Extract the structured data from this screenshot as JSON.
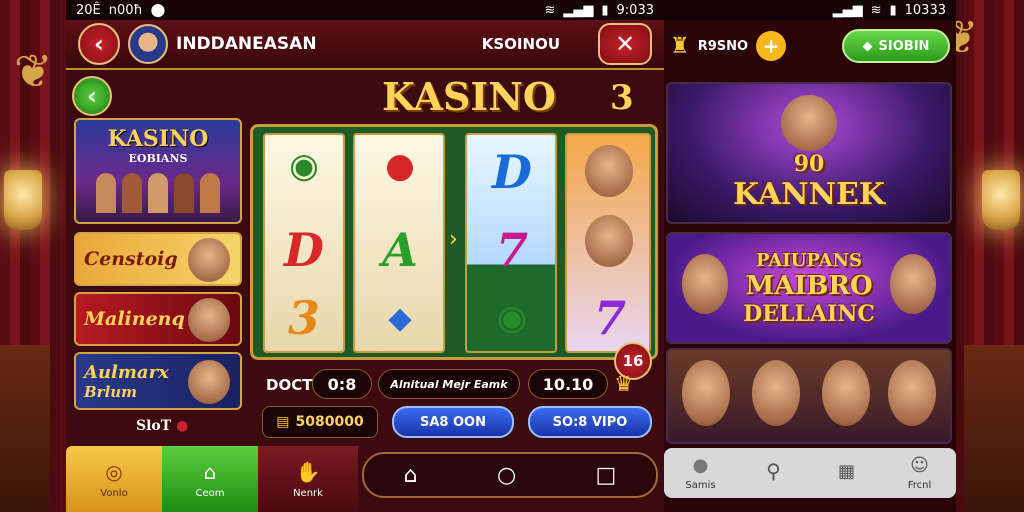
{
  "status_left": {
    "time": "20Ê",
    "carrier": "n00ħ"
  },
  "status_center": {
    "time": "9:033"
  },
  "status_right": {
    "time": "10333"
  },
  "header": {
    "username": "INDDANEASAN",
    "right_label": "KSOINOU"
  },
  "logo": "KASINO",
  "logo_badge": "3",
  "sidebar": {
    "items": [
      {
        "title": "KASINO",
        "subtitle": "EOBIANS"
      },
      {
        "title": "Censtoig"
      },
      {
        "title": "Malinenq"
      },
      {
        "title": "Aulmarx",
        "subtitle": "Brlum"
      }
    ],
    "footer": "SloT"
  },
  "reels": {
    "col2": [
      "A"
    ],
    "col3": [
      "D",
      "7"
    ],
    "col1": [
      "D",
      "3"
    ],
    "col4": [
      "7"
    ]
  },
  "bet_row": {
    "label": "DOCT",
    "value1": "0:8",
    "middle": "Alnitual Mejr Eamk",
    "value2": "10.10"
  },
  "corner_badge": "16",
  "action_row": {
    "coins": "5080000",
    "btn1": "SA8 OON",
    "btn2": "SO:8 VIPO"
  },
  "nav_left": [
    {
      "label": "Vonlo",
      "icon": "clock-icon"
    },
    {
      "label": "Ceom",
      "icon": "home-icon"
    },
    {
      "label": "Nenrk",
      "icon": "hand-icon"
    }
  ],
  "right_header": {
    "coins": "R9SNO",
    "signin": "SIOBIN"
  },
  "cards": [
    {
      "pre": "90",
      "title": "KANNEK"
    },
    {
      "title1": "PAIUPANS",
      "title2": "MAIBRO",
      "title3": "DELLAINC"
    }
  ],
  "nav_right": [
    {
      "label": "Samis",
      "icon": "circle-icon"
    },
    {
      "label": "",
      "icon": "search-icon"
    },
    {
      "label": "",
      "icon": "calendar-icon"
    },
    {
      "label": "Frcnl",
      "icon": "user-icon"
    }
  ],
  "colors": {
    "accent_gold": "#ffd35a",
    "button_red": "#c8232b",
    "button_green": "#3fb02a",
    "button_blue": "#2a50d8"
  }
}
